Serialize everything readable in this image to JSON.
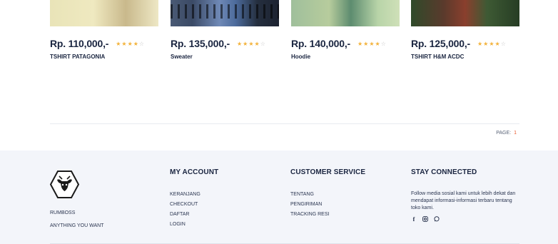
{
  "products": [
    {
      "price": "Rp. 110,000,-",
      "name": "TSHIRT PATAGONIA",
      "rating": 4,
      "max_rating": 5
    },
    {
      "price": "Rp. 135,000,-",
      "name": "Sweater",
      "rating": 4,
      "max_rating": 5
    },
    {
      "price": "Rp. 140,000,-",
      "name": "Hoodie",
      "rating": 4,
      "max_rating": 5
    },
    {
      "price": "Rp. 125,000,-",
      "name": "TSHIRT H&M ACDC",
      "rating": 4,
      "max_rating": 5
    }
  ],
  "pagination": {
    "label": "PAGE:",
    "current": "1"
  },
  "footer": {
    "brand": "RUMBOSS",
    "tagline": "ANYTHING YOU WANT",
    "my_account": {
      "title": "MY ACCOUNT",
      "items": [
        "KERANJANG",
        "CHECKOUT",
        "DAFTAR",
        "LOGIN"
      ]
    },
    "customer_service": {
      "title": "CUSTOMER SERVICE",
      "items": [
        "TENTANG",
        "PENGIRIMAN",
        "TRACKING RESI"
      ]
    },
    "stay_connected": {
      "title": "STAY CONNECTED",
      "description": "Follow media sosial kami untuk lebih dekat dan mendapat informasi-informasi terbaru tentang toko kami.",
      "social": [
        "facebook-icon",
        "instagram-icon",
        "whatsapp-icon"
      ]
    }
  },
  "colors": {
    "star": "#f3b23a",
    "page_accent": "#e8562a",
    "footer_bg": "#f3f5fa"
  }
}
